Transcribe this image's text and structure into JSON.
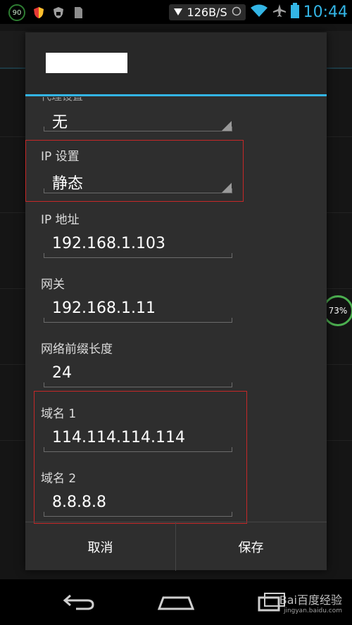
{
  "status_bar": {
    "badge": "90",
    "speed": "126B/S",
    "time": "10:44"
  },
  "side_badge": "73%",
  "dialog": {
    "cut_label": "代理设置",
    "proxy_value": "无",
    "ip_settings": {
      "label": "IP 设置",
      "value": "静态"
    },
    "ip_address": {
      "label": "IP 地址",
      "value": "192.168.1.103"
    },
    "gateway": {
      "label": "网关",
      "value": "192.168.1.11"
    },
    "prefix": {
      "label": "网络前缀长度",
      "value": "24"
    },
    "dns1": {
      "label": "域名 1",
      "value": "114.114.114.114"
    },
    "dns2": {
      "label": "域名 2",
      "value": "8.8.8.8"
    },
    "cancel_label": "取消",
    "save_label": "保存"
  },
  "watermark": {
    "brand": "Bai百度经验",
    "url": "jingyan.baidu.com"
  },
  "colors": {
    "accent": "#33b5e5",
    "highlight_box": "#c62828",
    "dialog_bg": "#2e2e2e"
  }
}
